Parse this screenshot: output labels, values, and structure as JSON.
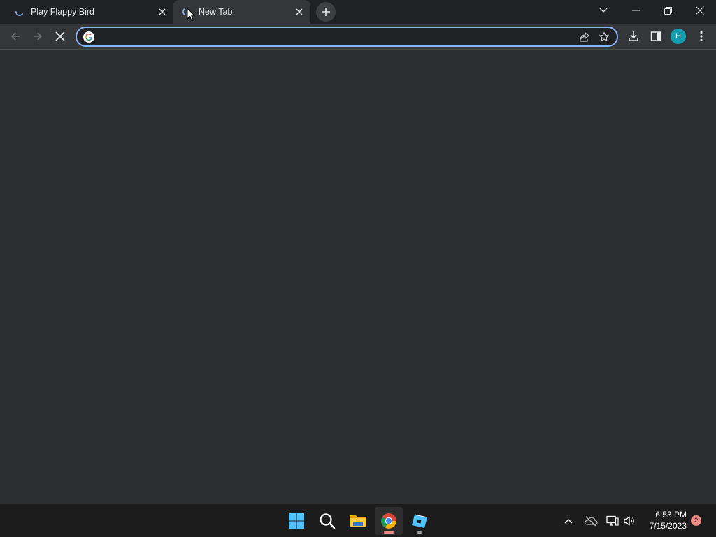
{
  "browser": {
    "tabs": [
      {
        "title": "Play Flappy Bird",
        "state": "loading",
        "active": false
      },
      {
        "title": "New Tab",
        "state": "loading",
        "active": true
      }
    ],
    "window_controls": [
      "tab-search",
      "minimize",
      "restore",
      "close"
    ],
    "toolbar": {
      "back_enabled": false,
      "forward_enabled": false,
      "reload_state": "stop",
      "omnibox": {
        "value": "",
        "placeholder": ""
      },
      "profile_initial": "H",
      "profile_color": "#129eaf"
    }
  },
  "taskbar": {
    "pinned_apps": [
      {
        "name": "Start",
        "icon": "windows-start-icon"
      },
      {
        "name": "Search",
        "icon": "search-icon"
      },
      {
        "name": "File Explorer",
        "icon": "folder-icon"
      },
      {
        "name": "Google Chrome",
        "icon": "chrome-icon",
        "active": true
      },
      {
        "name": "Roblox",
        "icon": "roblox-icon"
      }
    ],
    "tray": {
      "time": "6:53 PM",
      "date": "7/15/2023",
      "notification_count": "2"
    }
  },
  "colors": {
    "tabstrip_bg": "#202124",
    "toolbar_bg": "#35363a",
    "content_bg": "#2b2d31",
    "accent_blue": "#8ab4f8",
    "taskbar_bg": "#1c1c1c"
  }
}
